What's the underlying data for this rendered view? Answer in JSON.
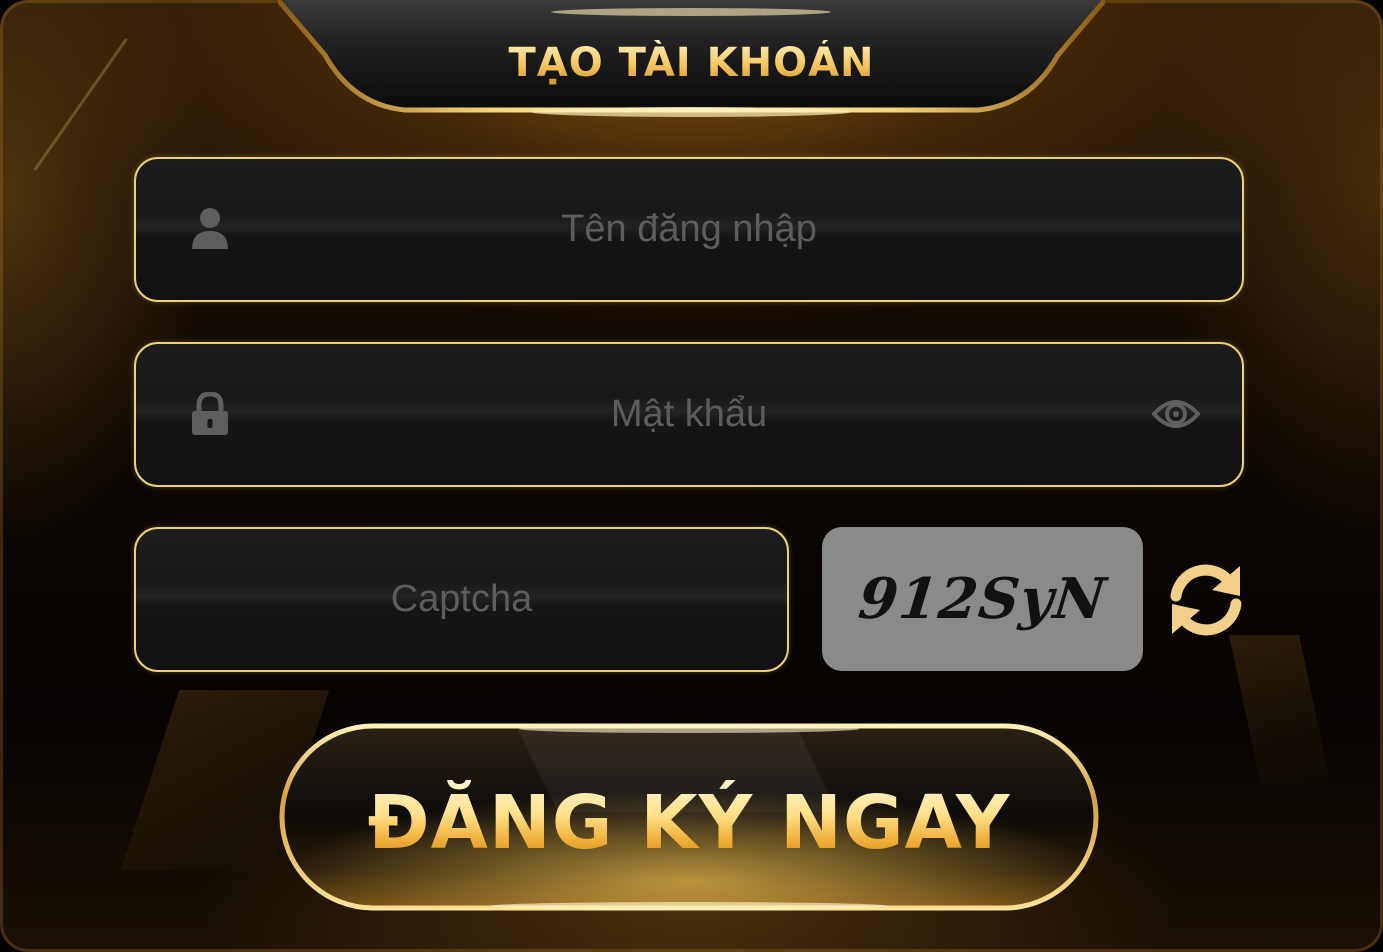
{
  "header": {
    "title": "TẠO TÀI KHOẢN"
  },
  "form": {
    "username": {
      "placeholder": "Tên đăng nhập",
      "value": "",
      "icon": "user-icon"
    },
    "password": {
      "placeholder": "Mật khẩu",
      "value": "",
      "icon": "lock-icon",
      "toggle_icon": "eye-icon"
    },
    "captcha": {
      "placeholder": "Captcha",
      "value": "",
      "code": "912SyN",
      "refresh_icon": "refresh-icon"
    }
  },
  "actions": {
    "register_label": "ĐĂNG KÝ NGAY"
  },
  "colors": {
    "gold": "#f5c65e",
    "field_border": "#e9d27a",
    "field_background": "#181818",
    "placeholder": "#5d5d5d",
    "captcha_background": "#8a8a8a"
  }
}
